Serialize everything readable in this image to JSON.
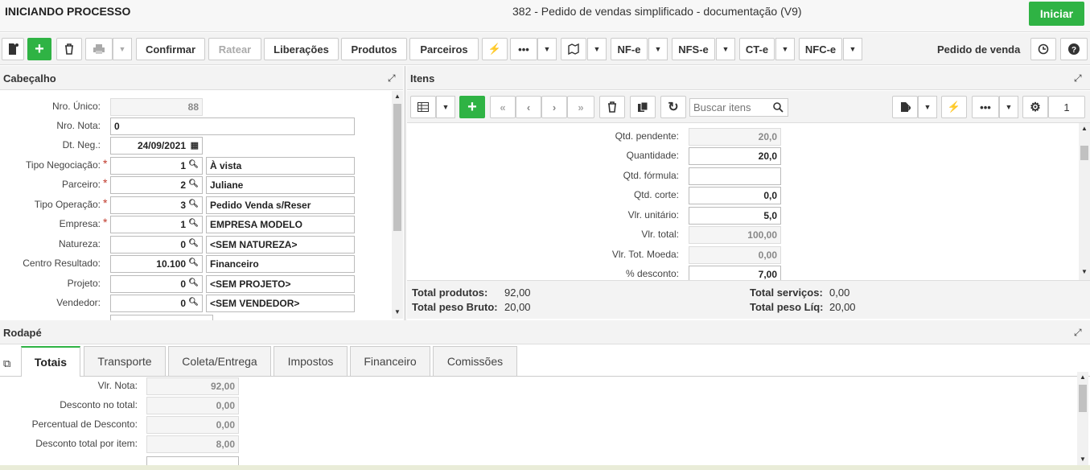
{
  "header": {
    "left_title": "INICIANDO PROCESSO",
    "center_title": "382 - Pedido de vendas simplificado - documentação (V9)",
    "start_button": "Iniciar"
  },
  "toolbar": {
    "confirm": "Confirmar",
    "rateio": "Ratear",
    "liberacoes": "Liberações",
    "produtos": "Produtos",
    "parceiros": "Parceiros",
    "more": "•••",
    "nfe": "NF-e",
    "nfse": "NFS-e",
    "cte": "CT-e",
    "nfce": "NFC-e",
    "context_label": "Pedido de venda"
  },
  "cabecalho": {
    "title": "Cabeçalho",
    "fields": [
      {
        "label": "Nro. Único:",
        "value": "88"
      },
      {
        "label": "Nro. Nota:",
        "value": "0"
      },
      {
        "label": "Dt. Neg.:",
        "value": "24/09/2021"
      },
      {
        "label": "Tipo Negociação:",
        "code": "1",
        "desc": "À vista"
      },
      {
        "label": "Parceiro:",
        "code": "2",
        "desc": "Juliane"
      },
      {
        "label": "Tipo Operação:",
        "code": "3",
        "desc": "Pedido Venda s/Reser"
      },
      {
        "label": "Empresa:",
        "code": "1",
        "desc": "EMPRESA MODELO"
      },
      {
        "label": "Natureza:",
        "code": "0",
        "desc": "<SEM NATUREZA>"
      },
      {
        "label": "Centro Resultado:",
        "code": "10.100",
        "desc": "Financeiro"
      },
      {
        "label": "Projeto:",
        "code": "0",
        "desc": "<SEM PROJETO>"
      },
      {
        "label": "Vendedor:",
        "code": "0",
        "desc": "<SEM VENDEDOR>"
      }
    ]
  },
  "itens": {
    "title": "Itens",
    "search_placeholder": "Buscar itens",
    "page": "1",
    "fields": [
      {
        "label": "Qtd. pendente:",
        "value": "20,0"
      },
      {
        "label": "Quantidade:",
        "value": "20,0"
      },
      {
        "label": "Qtd. fórmula:",
        "value": ""
      },
      {
        "label": "Qtd. corte:",
        "value": "0,0"
      },
      {
        "label": "Vlr. unitário:",
        "value": "5,0"
      },
      {
        "label": "Vlr. total:",
        "value": "100,00"
      },
      {
        "label": "Vlr. Tot. Moeda:",
        "value": "0,00"
      },
      {
        "label": "% desconto:",
        "value": "7,00"
      }
    ],
    "totals": {
      "produtos_label": "Total produtos:",
      "produtos_value": "92,00",
      "peso_bruto_label": "Total peso Bruto:",
      "peso_bruto_value": "20,00",
      "servicos_label": "Total serviços:",
      "servicos_value": "0,00",
      "peso_liq_label": "Total peso Líq:",
      "peso_liq_value": "20,00"
    }
  },
  "rodape": {
    "title": "Rodapé",
    "tabs": [
      "Totais",
      "Transporte",
      "Coleta/Entrega",
      "Impostos",
      "Financeiro",
      "Comissões"
    ],
    "fields": [
      {
        "label": "Vlr. Nota:",
        "value": "92,00"
      },
      {
        "label": "Desconto no total:",
        "value": "0,00"
      },
      {
        "label": "Percentual de Desconto:",
        "value": "0,00"
      },
      {
        "label": "Desconto total por item:",
        "value": "8,00"
      }
    ]
  },
  "colors": {
    "accent": "#2fb344",
    "required": "#c0392b"
  }
}
